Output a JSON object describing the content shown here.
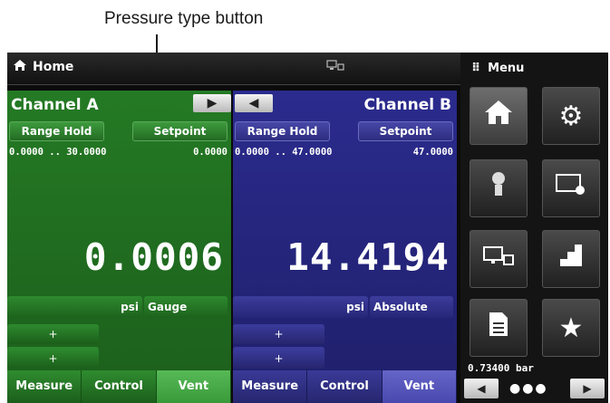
{
  "callout": {
    "label": "Pressure type button"
  },
  "topbar": {
    "home_label": "Home",
    "home_icon": "home-icon",
    "connection_icon": "network-connection-icon"
  },
  "channel_a": {
    "title": "Channel A",
    "arrow_icon": "triangle-right-icon",
    "range_hold_label": "Range Hold",
    "setpoint_label": "Setpoint",
    "range_text": "0.0000 ..  30.0000",
    "setpoint_value": "0.0000",
    "reading": "0.0006",
    "unit": "psi",
    "pressure_type": "Gauge",
    "plus_buttons": [
      "+",
      "+",
      "+"
    ],
    "tabs": [
      "Measure",
      "Control",
      "Vent"
    ],
    "active_tab": "Vent",
    "color": "#247a24"
  },
  "channel_b": {
    "title": "Channel B",
    "arrow_icon": "triangle-left-icon",
    "range_hold_label": "Range Hold",
    "setpoint_label": "Setpoint",
    "range_text": "0.0000 ..  47.0000",
    "setpoint_value": "47.0000",
    "reading": "14.4194",
    "unit": "psi",
    "pressure_type": "Absolute",
    "plus_buttons": [
      "+",
      "+",
      "+"
    ],
    "tabs": [
      "Measure",
      "Control",
      "Vent"
    ],
    "active_tab": "Vent",
    "color": "#2b2b8e"
  },
  "menu": {
    "title": "Menu",
    "tiles": [
      "home-icon",
      "settings-gears-icon",
      "sensor-icon",
      "display-settings-icon",
      "remote-connection-icon",
      "steps-icon",
      "document-icon",
      "star-icon"
    ],
    "barometer": "0.73400  bar",
    "pager": "●●●"
  }
}
